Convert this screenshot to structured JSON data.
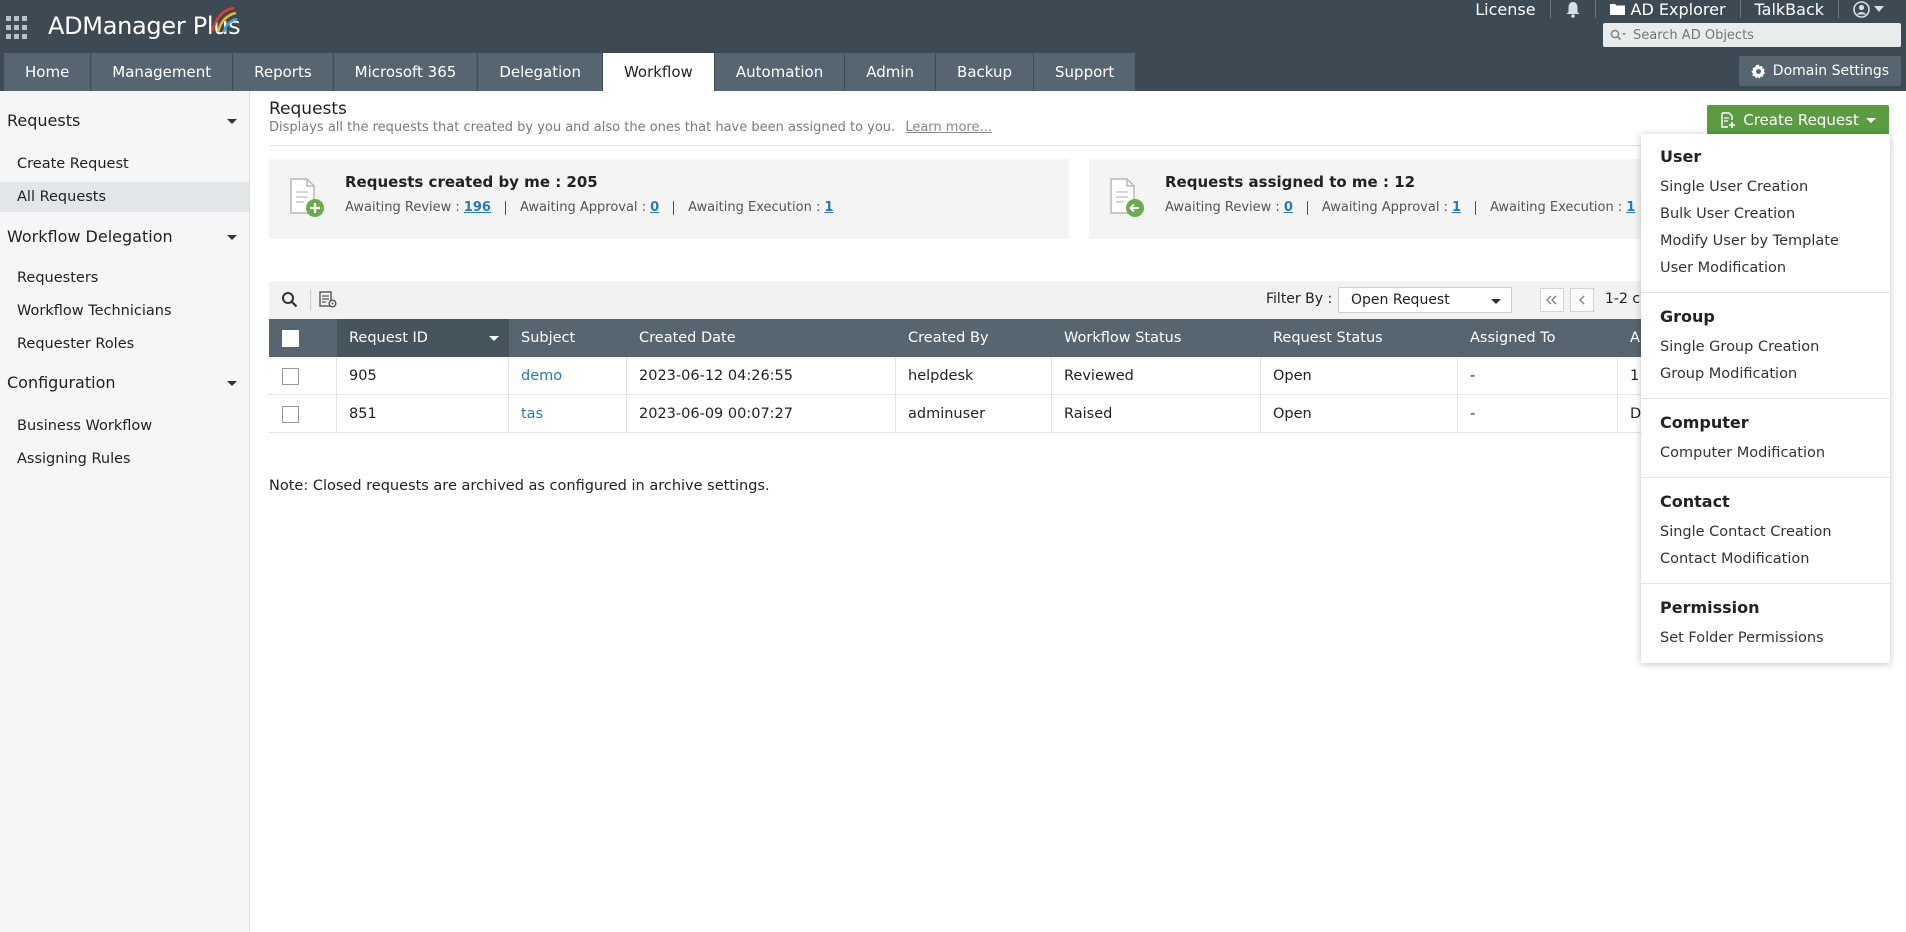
{
  "app": {
    "logo_text": "ADManager Plus"
  },
  "top_links": {
    "license": "License",
    "ad_explorer": "AD Explorer",
    "talkback": "TalkBack"
  },
  "search": {
    "placeholder": "Search AD Objects"
  },
  "nav": {
    "tabs": [
      "Home",
      "Management",
      "Reports",
      "Microsoft 365",
      "Delegation",
      "Workflow",
      "Automation",
      "Admin",
      "Backup",
      "Support"
    ],
    "active": "Workflow",
    "domain_settings": "Domain Settings"
  },
  "sidebar": {
    "sections": [
      {
        "title": "Requests",
        "items": [
          "Create Request",
          "All Requests"
        ]
      },
      {
        "title": "Workflow Delegation",
        "items": [
          "Requesters",
          "Workflow Technicians",
          "Requester Roles"
        ]
      },
      {
        "title": "Configuration",
        "items": [
          "Business Workflow",
          "Assigning Rules"
        ]
      }
    ],
    "active_item": "All Requests"
  },
  "main": {
    "title": "Requests",
    "description": "Displays all the requests that created by you and also the ones that have been assigned to you.",
    "learn_more": "Learn more...",
    "create_request": "Create Request"
  },
  "cards": {
    "created": {
      "title": "Requests created by me : 205",
      "awaiting_review_label": "Awaiting Review :",
      "awaiting_review": "196",
      "awaiting_approval_label": "Awaiting Approval :",
      "awaiting_approval": "0",
      "awaiting_execution_label": "Awaiting Execution :",
      "awaiting_execution": "1"
    },
    "assigned": {
      "title": "Requests assigned to me : 12",
      "awaiting_review_label": "Awaiting Review :",
      "awaiting_review": "0",
      "awaiting_approval_label": "Awaiting Approval :",
      "awaiting_approval": "1",
      "awaiting_execution_label": "Awaiting Execution :",
      "awaiting_execution": "1"
    }
  },
  "toolbar": {
    "filter_label": "Filter By :",
    "filter_value": "Open Request",
    "pager_text": "1-2 c"
  },
  "table": {
    "columns": [
      "Request ID",
      "Subject",
      "Created Date",
      "Created By",
      "Workflow Status",
      "Request Status",
      "Assigned To",
      "A"
    ],
    "rows": [
      {
        "id": "905",
        "subject": "demo",
        "created_date": "2023-06-12 04:26:55",
        "created_by": "helpdesk",
        "workflow_status": "Reviewed",
        "request_status": "Open",
        "assigned_to": "-",
        "extra": "1"
      },
      {
        "id": "851",
        "subject": "tas",
        "created_date": "2023-06-09 00:07:27",
        "created_by": "adminuser",
        "workflow_status": "Raised",
        "request_status": "Open",
        "assigned_to": "-",
        "extra": "D"
      }
    ]
  },
  "note": "Note: Closed requests are archived as configured in archive settings.",
  "dropdown": {
    "groups": [
      {
        "title": "User",
        "items": [
          "Single User Creation",
          "Bulk User Creation",
          "Modify User by Template",
          "User Modification"
        ]
      },
      {
        "title": "Group",
        "items": [
          "Single Group Creation",
          "Group Modification"
        ]
      },
      {
        "title": "Computer",
        "items": [
          "Computer Modification"
        ]
      },
      {
        "title": "Contact",
        "items": [
          "Single Contact Creation",
          "Contact Modification"
        ]
      },
      {
        "title": "Permission",
        "items": [
          "Set Folder Permissions"
        ]
      }
    ]
  },
  "colors": {
    "header_bg": "#3d4a54",
    "tab_bg": "#56656f",
    "accent_green": "#5c9a43",
    "link_blue": "#2a7ab0"
  }
}
